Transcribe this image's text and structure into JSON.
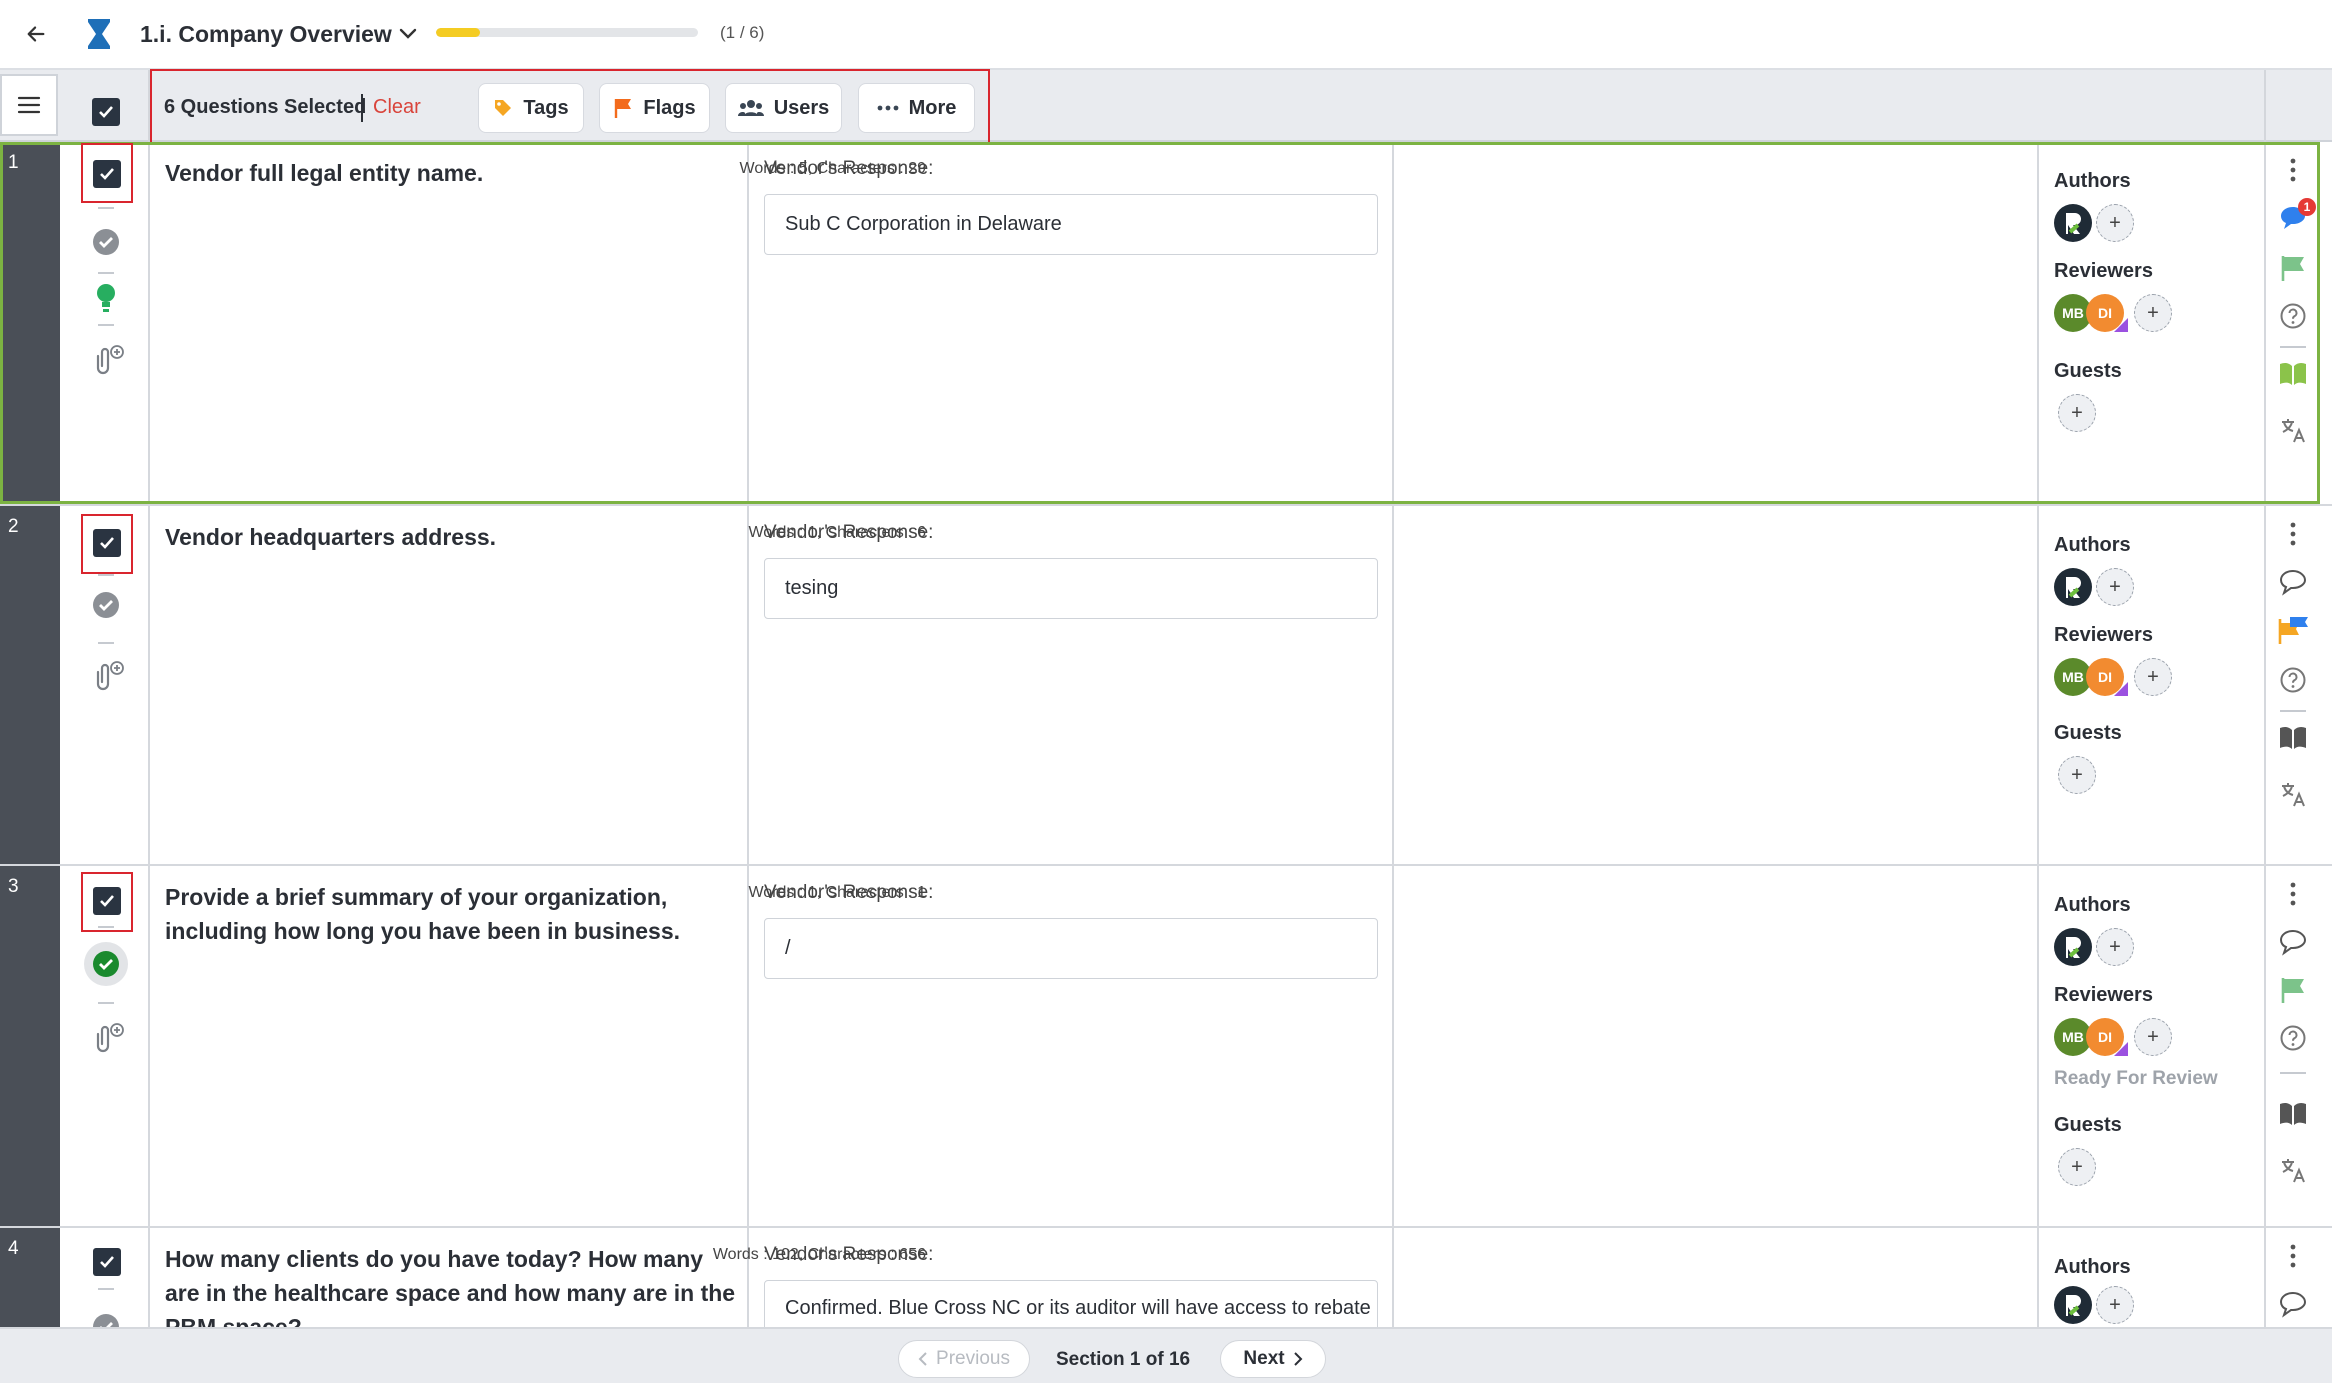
{
  "header": {
    "section_title": "1.i. Company Overview",
    "progress_text": "(1 / 6)",
    "progress_fraction": 0.167,
    "progress_color": "#f4cc23"
  },
  "toolbar": {
    "selected_text": "6 Questions Selected",
    "clear_label": "Clear",
    "buttons": {
      "tags": "Tags",
      "flags": "Flags",
      "users": "Users",
      "more": "More"
    }
  },
  "labels": {
    "vendor_response": "Vendor's Response:",
    "authors": "Authors",
    "reviewers": "Reviewers",
    "guests": "Guests",
    "add": "+"
  },
  "reviewer_initials": {
    "mb": "MB",
    "di": "DI"
  },
  "questions": [
    {
      "number": "1",
      "text": "Vendor full legal entity name.",
      "counts": "Words : 5, Characters : 29",
      "response": "Sub C Corporation in Delaware",
      "comment_badge": "1"
    },
    {
      "number": "2",
      "text": "Vendor headquarters address.",
      "counts": "Words : 1, Characters : 6",
      "response": "tesing"
    },
    {
      "number": "3",
      "text": "Provide a brief summary of your organization, including how long you have been in business.",
      "counts": "Words : 1, Characters : 1",
      "response": "/",
      "status": "Ready For Review"
    },
    {
      "number": "4",
      "text": "How many clients do you have today? How many are in the healthcare space and how many are in the PBM space?",
      "counts": "Words : 102, Characters : 656",
      "response": "Confirmed. Blue Cross NC or its auditor will have access to rebate manufacturer contracts, whether the contracts are held directly"
    }
  ],
  "footer": {
    "previous": "Previous",
    "section": "Section 1 of 16",
    "next": "Next"
  },
  "colors": {
    "accent_green": "#7cb342",
    "highlight_red": "#d9252e",
    "flag_orange": "#f36b1c",
    "comment_blue": "#2f80ed"
  }
}
